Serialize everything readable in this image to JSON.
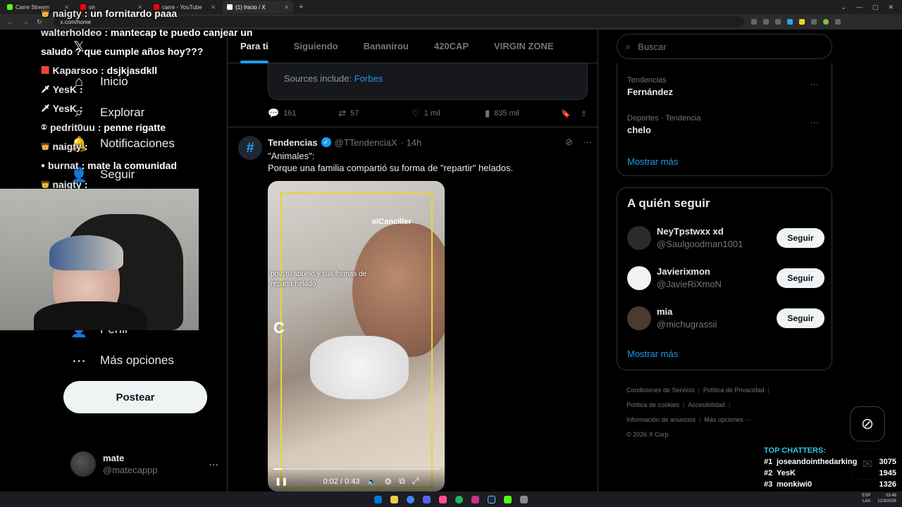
{
  "browser": {
    "tabs": [
      {
        "label": "Carre Stream",
        "color": "#53fc18",
        "active": false
      },
      {
        "label": "on",
        "color": "#ff0000",
        "active": false
      },
      {
        "label": "carre - YouTube",
        "color": "#ff0000",
        "active": false
      },
      {
        "label": "(1) Inicio / X",
        "color": "#ffffff",
        "active": true
      }
    ],
    "new_tab": "+",
    "url": "x.com/home"
  },
  "left_nav": {
    "items": [
      {
        "icon": "x-logo-icon",
        "glyph": "𝕏",
        "label": ""
      },
      {
        "icon": "home-icon",
        "glyph": "⌂",
        "label": "Inicio"
      },
      {
        "icon": "search-icon",
        "glyph": "⌕",
        "label": "Explorar"
      },
      {
        "icon": "bell-icon",
        "glyph": "🔔",
        "label": "Notificaciones"
      },
      {
        "icon": "person-plus-icon",
        "glyph": "👤",
        "label": "Seguir"
      },
      {
        "icon": "profile-icon",
        "glyph": "👤",
        "label": "Perfil"
      },
      {
        "icon": "more-circle-icon",
        "glyph": "⋯",
        "label": "Más opciones"
      }
    ],
    "post_button": "Postear",
    "profile": {
      "name": "mate",
      "handle": "@matecappp",
      "more": "···"
    }
  },
  "feed": {
    "tabs": [
      "Para ti",
      "Siguiendo",
      "Bananirou",
      "420CAP",
      "VIRGIN ZONE"
    ],
    "active_tab": 0,
    "prev_card": {
      "prefix": "Sources include: ",
      "link": "Forbes"
    },
    "prev_actions": {
      "replies": "161",
      "reposts": "57",
      "likes": "1 mil",
      "views": "835 mil"
    },
    "tweet": {
      "avatar_glyph": "#",
      "name": "Tendencias",
      "handle": "@TTendenciaX",
      "time": "· 14h",
      "text_line1": "\"Animales\":",
      "text_line2": "Porque una familia compartió su forma de \"repartir\" helados.",
      "video": {
        "watermark": "elCanciller",
        "caption": "pov: tu abuelo y sus formas de repartir helado",
        "letter": "C",
        "time": "0:02 / 0:43",
        "progress": 0.05
      }
    }
  },
  "right": {
    "search_placeholder": "Buscar",
    "trends": [
      {
        "category": "Tendencias",
        "name": "Fernández"
      },
      {
        "category": "Deportes · Tendencia",
        "name": "chelo"
      }
    ],
    "trends_more": "Mostrar más",
    "follow_title": "A quién seguir",
    "follow": [
      {
        "name": "NeyTpstwxx xd",
        "handle": "@Saulgoodman1001",
        "button": "Seguir",
        "color": "#2b2b2b"
      },
      {
        "name": "Javierixmon",
        "handle": "@JavieRiXmoN",
        "button": "Seguir",
        "color": "#f2f2f2"
      },
      {
        "name": "mia",
        "handle": "@michugrassii",
        "button": "Seguir",
        "color": "#4a3a30"
      }
    ],
    "follow_more": "Mostrar más",
    "footer": [
      "Condiciones de Servicio",
      "Política de Privacidad",
      "Política de cookies",
      "Accesibilidad",
      "Información de anuncios",
      "Más opciones ···",
      "© 2026 X Corp."
    ]
  },
  "stream": {
    "chat": [
      {
        "user": "naigty",
        "msg": ": un fornitardo paaa"
      },
      {
        "user": "walterholdeo",
        "msg": ": mantecap te puedo canjear un"
      },
      {
        "user": "",
        "msg": "saludo ? que cumple años hoy???"
      },
      {
        "user": "Kaparsoo",
        "msg": ": dsjkjasdkll"
      },
      {
        "user": "YesK",
        "msg": ": "
      },
      {
        "user": "YesK",
        "msg": ": "
      },
      {
        "user": "pedrit0uu",
        "msg": ": penne rigatte"
      },
      {
        "user": "naigty",
        "msg": ": "
      },
      {
        "user": "burnat",
        "msg": ": mate la comunidad"
      },
      {
        "user": "naigty",
        "msg": ": "
      }
    ],
    "top_chatters_title": "TOP CHATTERS:",
    "top_chatters": [
      {
        "rank": "#1",
        "name": "joseandointhedarking",
        "count": "3075"
      },
      {
        "rank": "#2",
        "name": "YesK",
        "count": "1945"
      },
      {
        "rank": "#3",
        "name": "monkiwi0",
        "count": "1326"
      }
    ]
  },
  "taskbar": {
    "icons": [
      "#0078d4",
      "#f2c94c",
      "#4285f4",
      "#5865f2",
      "#ff4f8b",
      "#1db954",
      "#c13584",
      "#1b2838",
      "#53fc18",
      "#888888"
    ],
    "lang": "ESP\nLAA",
    "clock": "03:48\n12/3/2026"
  }
}
